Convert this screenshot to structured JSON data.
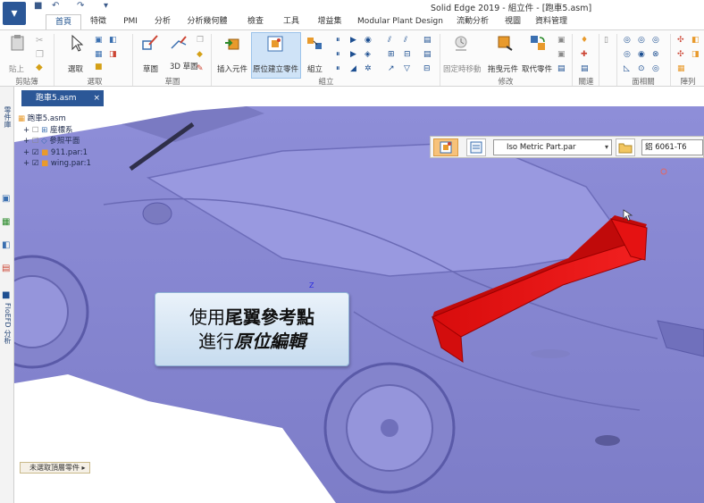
{
  "titlebar": {
    "title": "Solid Edge 2019 - 組立件 - [跑車5.asm]"
  },
  "tabs": [
    "首頁",
    "特徵",
    "PMI",
    "分析",
    "分析幾何體",
    "檢查",
    "工具",
    "增益集",
    "Modular Plant Design",
    "流動分析",
    "視圖",
    "資料管理"
  ],
  "ribbon": {
    "clipboard": {
      "paste": "貼上",
      "group": "剪貼簿"
    },
    "select": {
      "select": "選取",
      "group": "選取"
    },
    "sketch": {
      "sketch": "草圖",
      "sketch_3d": "3D 草圖",
      "group": "草圖"
    },
    "assemble": {
      "insert_part": "插入元件",
      "create_in_place": "原位建立零件",
      "assemble": "組立",
      "group": "組立"
    },
    "modify": {
      "fixed_time": "固定時移動",
      "drag_component": "拖曳元件",
      "replace_part": "取代零件",
      "group": "修改"
    },
    "relate": {
      "group": "關連"
    },
    "face_relate": {
      "group": "面相關"
    },
    "pattern": {
      "group": "陣列"
    }
  },
  "left_strip": {
    "tab1": "零件庫",
    "tab2": "FloEFD 分析"
  },
  "document_tab": {
    "name": "跑車5.asm",
    "close": "×"
  },
  "tree": {
    "root": "跑車5.asm",
    "items": [
      {
        "label": "座標系"
      },
      {
        "label": "參照平面"
      },
      {
        "label": "911.par:1"
      },
      {
        "label": "wing.par:1"
      }
    ]
  },
  "command_bar": {
    "template": "Iso Metric Part.par",
    "material": "鋁 6061-T6"
  },
  "callout": {
    "line1_prefix": "使用",
    "line1_bold": "尾翼參考點",
    "line2_prefix": "進行",
    "line2_italic": "原位編輯"
  },
  "status_chip": "未選取頂層零件",
  "axis_label": "Z",
  "colors": {
    "car_body": "#8f8fd6",
    "wing": "#e51212",
    "accent": "#2b5797"
  }
}
